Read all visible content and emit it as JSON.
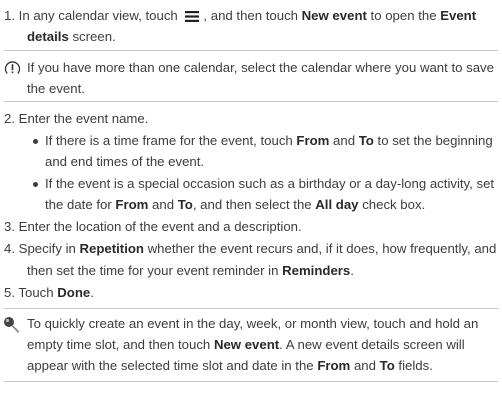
{
  "step1": {
    "a": "1. In any calendar view, touch ",
    "b": ", and then touch ",
    "new_event": "New event",
    "c": " to open the ",
    "event": "Event",
    "details": "details",
    "d": " screen."
  },
  "note1": {
    "icon": "info-icon",
    "line1": "If you have more than one calendar, select the calendar where you want to save",
    "line2": "the event."
  },
  "step2": "2. Enter the event name.",
  "bullet1": {
    "a": "If there is a time frame for the event, touch ",
    "from": "From",
    "and": " and ",
    "to": "To",
    "b": " to set the beginning",
    "line2": "and end times of the event."
  },
  "bullet2": {
    "line1": "If the event is a special occasion such as a birthday or a day-long activity, set",
    "a": "the date for ",
    "from": "From",
    "and": " and ",
    "to": "To",
    "b": ", and then select the ",
    "allday": "All day",
    "c": " check box."
  },
  "step3": "3. Enter the location of the event and a description.",
  "step4": {
    "a": "4. Specify in ",
    "repetition": "Repetition",
    "b": " whether the event recurs and, if it does, how frequently, and",
    "c": "then set the time for your event reminder in ",
    "reminders": "Reminders",
    "d": "."
  },
  "step5": {
    "a": "5. Touch ",
    "done": "Done",
    "b": "."
  },
  "tip": {
    "icon": "tip-icon",
    "line1": "To quickly create an event in the day, week, or month view, touch and hold an",
    "a": "empty time slot, and then touch ",
    "new_event": "New event",
    "b": ". A new event details screen will",
    "c": "appear with the selected time slot and date in the ",
    "from": "From",
    "and": " and ",
    "to": "To",
    "d": " fields."
  },
  "colors": {
    "text": "#3d3d3d",
    "rule": "#c9c9c9"
  }
}
